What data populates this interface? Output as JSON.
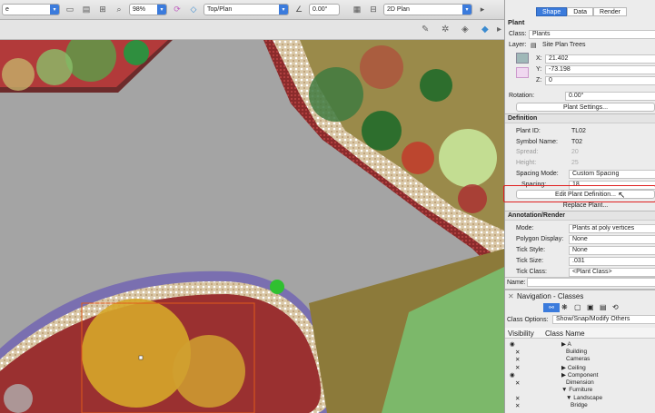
{
  "toolbar": {
    "class_select": "e",
    "zoom": "98%",
    "view": "Top/Plan",
    "angle": "0.00°",
    "projection": "2D Plan"
  },
  "panel": {
    "tabs": [
      "Shape",
      "Data",
      "Render"
    ],
    "object_type": "Plant",
    "class_label": "Class:",
    "class_value": "Plants",
    "layer_label": "Layer:",
    "layer_value": "Site Plan Trees",
    "x_label": "X:",
    "x_value": "21.402",
    "y_label": "Y:",
    "y_value": "-73.198",
    "z_label": "Z:",
    "z_value": "0",
    "rotation_label": "Rotation:",
    "rotation_value": "0.00°",
    "plant_settings_button": "Plant Settings...",
    "definition_header": "Definition",
    "plant_id_label": "Plant ID:",
    "plant_id_value": "TL02",
    "symbol_name_label": "Symbol Name:",
    "symbol_name_value": "T02",
    "spread_label": "Spread:",
    "spread_value": "20",
    "height_label": "Height:",
    "height_value": "25",
    "spacing_mode_label": "Spacing Mode:",
    "spacing_mode_value": "Custom Spacing",
    "spacing_label": "Spacing:",
    "spacing_value": "18",
    "edit_definition_button": "Edit Plant Definition...",
    "replace_plant_button": "Replace Plant...",
    "annotation_header": "Annotation/Render",
    "mode_label": "Mode:",
    "mode_value": "Plants at poly vertices",
    "polygon_display_label": "Polygon Display:",
    "polygon_display_value": "None",
    "tick_style_label": "Tick Style:",
    "tick_style_value": "None",
    "tick_size_label": "Tick Size:",
    "tick_size_value": ".031",
    "tick_class_label": "Tick Class:",
    "tick_class_value": "<Plant Class>",
    "name_label": "Name:"
  },
  "navigation": {
    "title": "Navigation - Classes",
    "class_options_label": "Class Options:",
    "class_options_value": "Show/Snap/Modify Others",
    "col_visibility": "Visibility",
    "col_class_name": "Class Name",
    "rows": [
      {
        "vis": "eye-icon",
        "mark": "",
        "name": "A",
        "indent": 0,
        "arrow": "▶"
      },
      {
        "vis": "",
        "mark": "✕",
        "name": "Building",
        "indent": 1,
        "arrow": ""
      },
      {
        "vis": "",
        "mark": "✕",
        "name": "Cameras",
        "indent": 1,
        "arrow": ""
      },
      {
        "vis": "",
        "mark": "✕",
        "name": "Ceiling",
        "indent": 0,
        "arrow": "▶"
      },
      {
        "vis": "eye-icon",
        "mark": "",
        "name": "Component",
        "indent": 0,
        "arrow": "▶"
      },
      {
        "vis": "",
        "mark": "✕",
        "name": "Dimension",
        "indent": 1,
        "arrow": ""
      },
      {
        "vis": "",
        "mark": "",
        "name": "Furniture",
        "indent": 0,
        "arrow": "▼"
      },
      {
        "vis": "",
        "mark": "✕",
        "name": "Landscape",
        "indent": 1,
        "arrow": "▼"
      },
      {
        "vis": "",
        "mark": "✕",
        "name": "Bridge",
        "indent": 2,
        "arrow": ""
      }
    ]
  },
  "colors": {
    "accent": "#3b7bdc",
    "highlight": "#e02020"
  }
}
